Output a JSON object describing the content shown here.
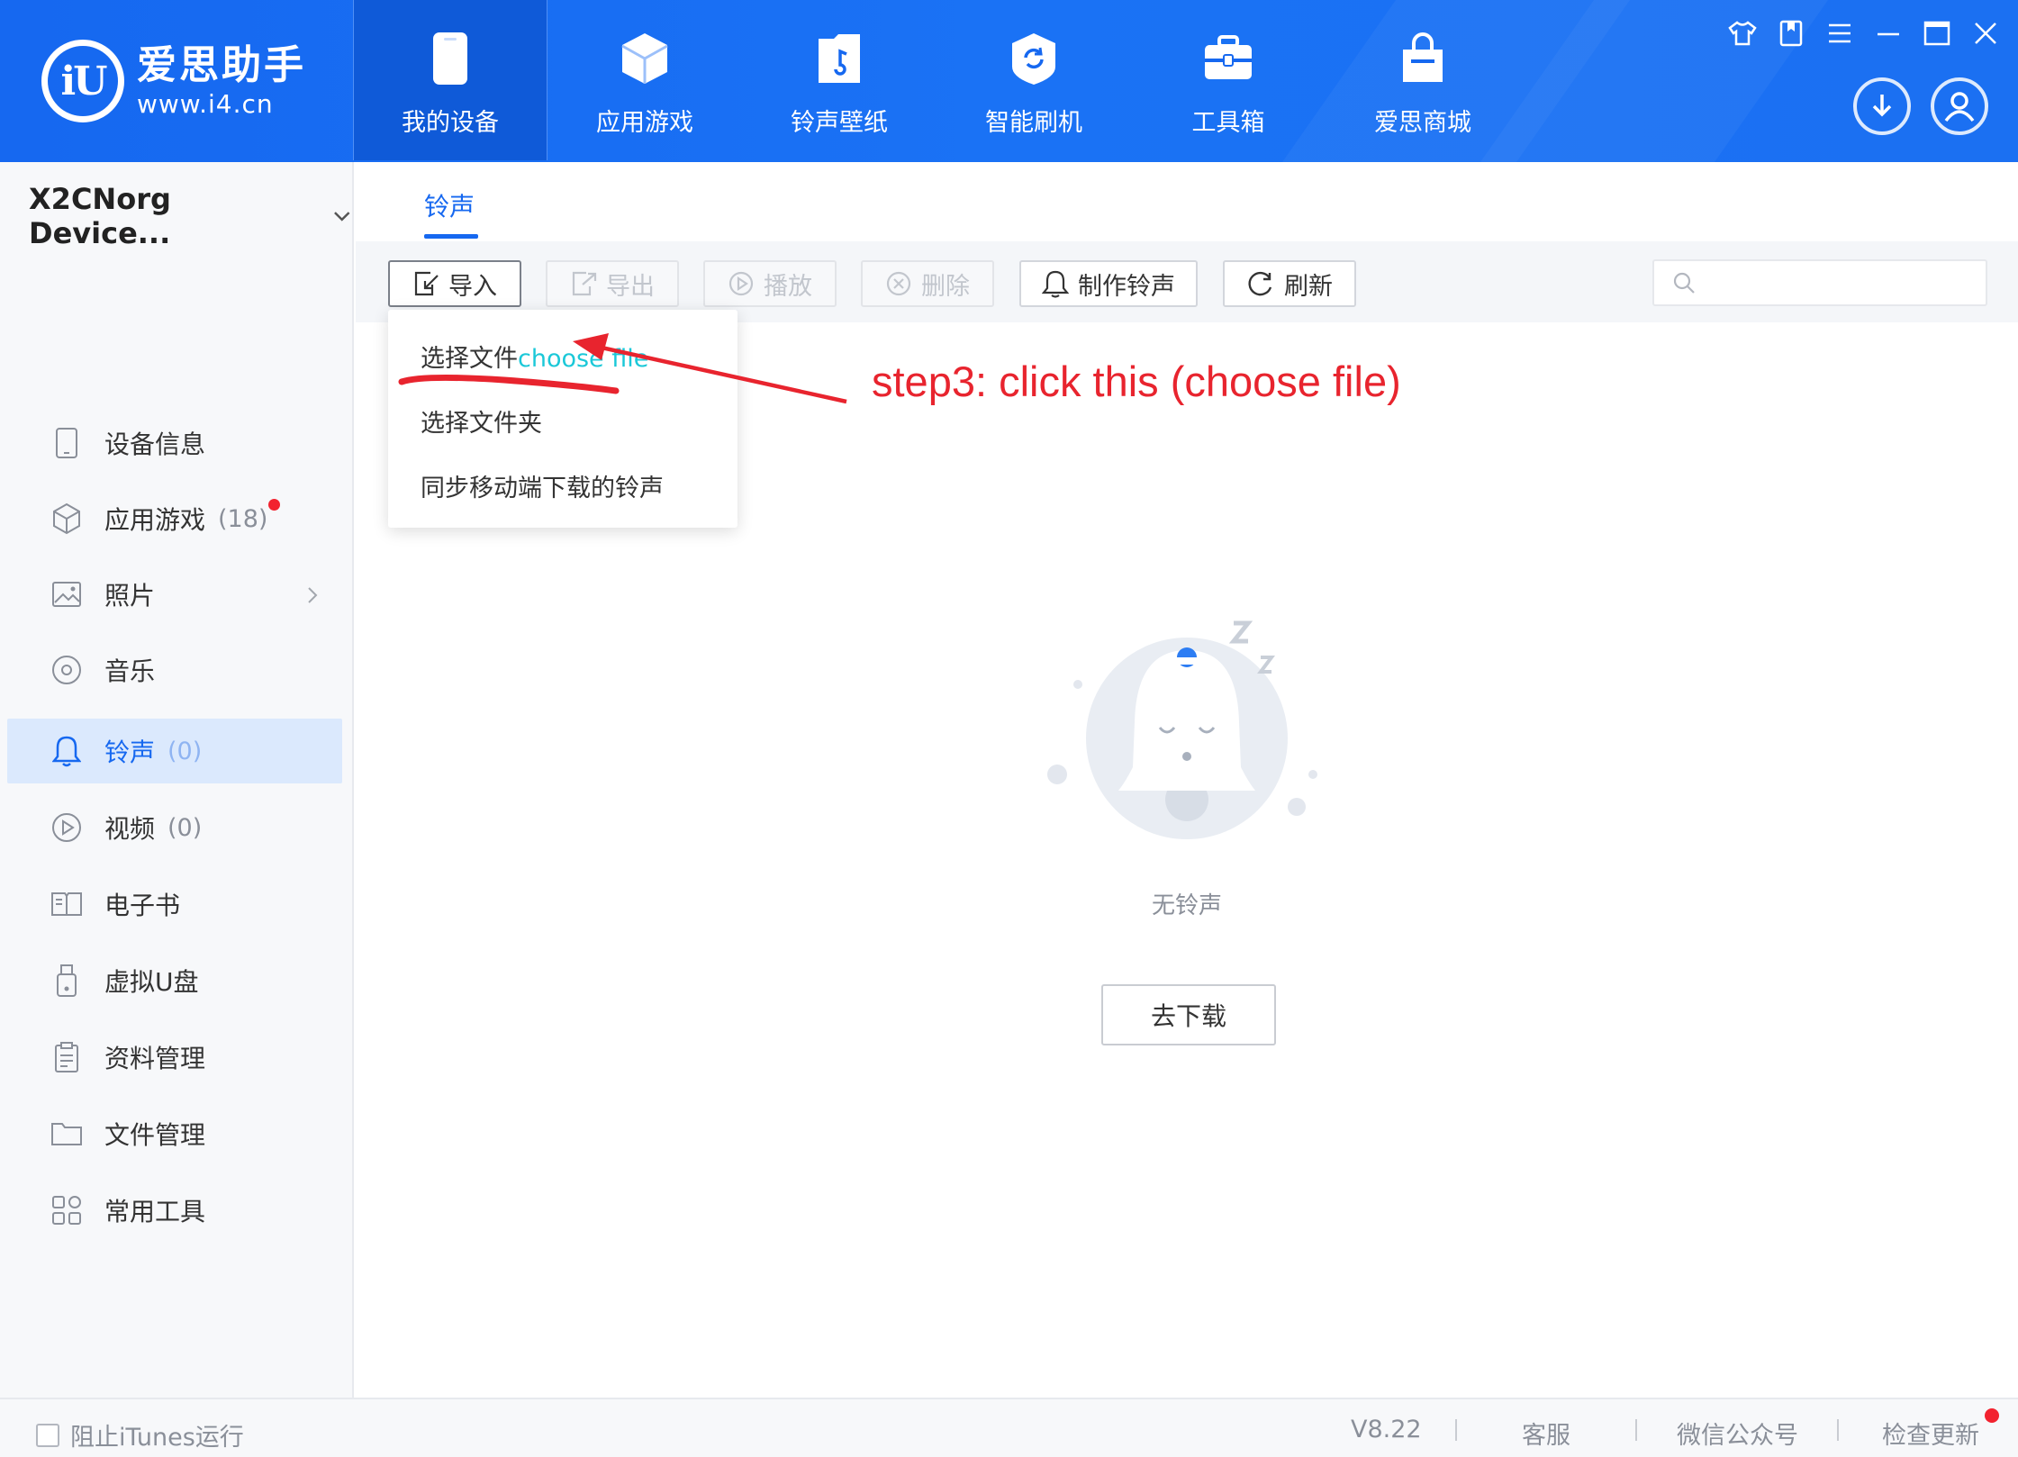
{
  "app": {
    "logo_name": "爱思助手",
    "logo_url": "www.i4.cn",
    "logo_mark": "iU"
  },
  "nav": [
    {
      "label": "我的设备",
      "icon": "phone-icon",
      "active": true
    },
    {
      "label": "应用游戏",
      "icon": "cube-icon",
      "active": false
    },
    {
      "label": "铃声壁纸",
      "icon": "music-folder-icon",
      "active": false
    },
    {
      "label": "智能刷机",
      "icon": "refresh-shield-icon",
      "active": false
    },
    {
      "label": "工具箱",
      "icon": "toolbox-icon",
      "active": false
    },
    {
      "label": "爱思商城",
      "icon": "shopping-bag-icon",
      "active": false
    }
  ],
  "window_controls": [
    "shirt-icon",
    "bookmark-icon",
    "menu-icon",
    "minimize-icon",
    "maximize-icon",
    "close-icon"
  ],
  "sidebar": {
    "device_name": "X2CNorg Device...",
    "items": [
      {
        "label": "设备信息",
        "count": "",
        "icon": "device-info-icon"
      },
      {
        "label": "应用游戏",
        "count": "(18)",
        "icon": "app-cube-icon",
        "badge": true
      },
      {
        "label": "照片",
        "count": "",
        "icon": "photo-icon",
        "chevron": true
      },
      {
        "label": "音乐",
        "count": "",
        "icon": "music-disc-icon"
      },
      {
        "label": "铃声",
        "count": "(0)",
        "icon": "bell-icon",
        "active": true
      },
      {
        "label": "视频",
        "count": "(0)",
        "icon": "video-play-icon"
      },
      {
        "label": "电子书",
        "count": "",
        "icon": "ebook-icon"
      },
      {
        "label": "虚拟U盘",
        "count": "",
        "icon": "usb-drive-icon"
      },
      {
        "label": "资料管理",
        "count": "",
        "icon": "document-icon"
      },
      {
        "label": "文件管理",
        "count": "",
        "icon": "folder-icon"
      },
      {
        "label": "常用工具",
        "count": "",
        "icon": "grid-tools-icon"
      }
    ]
  },
  "tabs": {
    "ringtone": "铃声"
  },
  "toolbar": {
    "import": "导入",
    "export": "导出",
    "play": "播放",
    "delete": "删除",
    "make_ringtone": "制作铃声",
    "refresh": "刷新",
    "search_placeholder": ""
  },
  "import_menu": {
    "choose_file": "选择文件",
    "choose_file_annotation": "choose file",
    "choose_folder": "选择文件夹",
    "sync_mobile": "同步移动端下载的铃声"
  },
  "annotation": {
    "text": "step3: click this (choose file)",
    "color": "#e8242e"
  },
  "empty_state": {
    "text": "无铃声",
    "button": "去下载"
  },
  "footer": {
    "block_itunes": "阻止iTunes运行",
    "version": "V8.22",
    "support": "客服",
    "wechat": "微信公众号",
    "check_update": "检查更新"
  },
  "colors": {
    "accent": "#1668f0",
    "annotation": "#e8242e",
    "badge": "#f2222f",
    "annotation_cyan": "#1bc8d8"
  }
}
